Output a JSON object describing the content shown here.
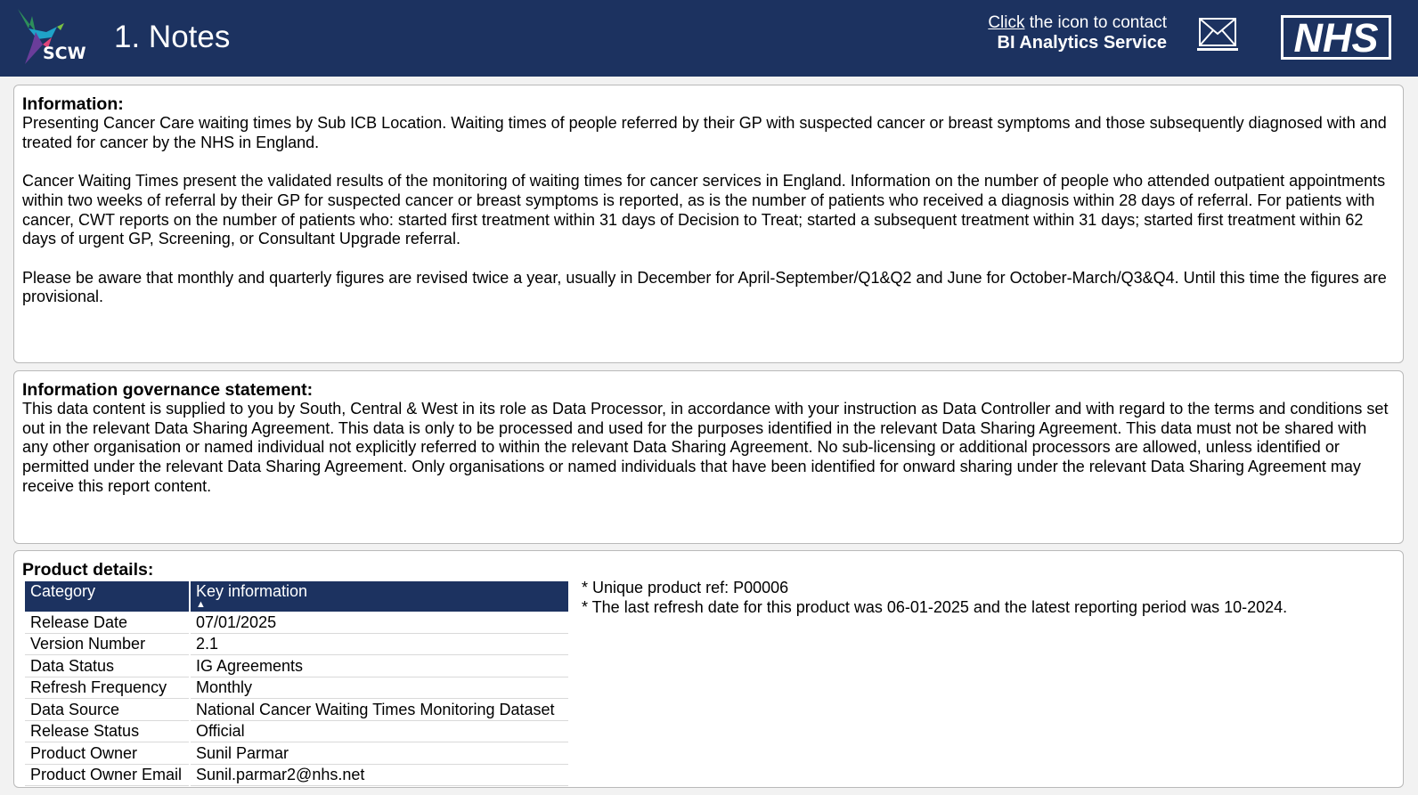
{
  "header": {
    "logo_text": "SCW",
    "title": "1. Notes",
    "contact_link": "Click",
    "contact_text": " the icon to contact",
    "contact_service": "BI Analytics Service",
    "mail_icon": "envelope-icon",
    "nhs_logo_text": "NHS",
    "colors": {
      "header_bg": "#1c3260",
      "text": "#ffffff"
    }
  },
  "information": {
    "heading": "Information:",
    "paragraphs": [
      "Presenting Cancer Care waiting times by Sub ICB Location. Waiting times of people referred by their GP with suspected cancer or breast symptoms and those subsequently diagnosed with and treated for cancer by the NHS in England.",
      "Cancer Waiting Times present the validated results of the monitoring of waiting times for cancer services in England. Information on the number of people who attended outpatient appointments within two weeks of referral by their GP for suspected cancer or breast symptoms is reported, as is the number of patients who received a diagnosis within 28 days of referral. For patients with cancer, CWT reports on the number of patients who: started first treatment within 31 days of Decision to Treat; started a subsequent treatment within 31 days; started first treatment within 62 days of urgent GP, Screening, or Consultant Upgrade referral.",
      "Please be aware that monthly and quarterly figures are revised twice a year, usually in December for April-September/Q1&Q2 and June for October-March/Q3&Q4. Until this time the figures are provisional."
    ]
  },
  "governance": {
    "heading": "Information governance statement:",
    "text": "This data content is supplied to you by South, Central & West in its role as Data Processor, in accordance with your instruction as Data Controller and with regard to the terms and conditions set out in the relevant Data Sharing Agreement. This data is only to be processed and used for the purposes identified in the relevant Data Sharing Agreement. This data must not be shared with any other organisation or named individual not explicitly referred to within the relevant Data Sharing Agreement. No sub-licensing or additional processors are allowed, unless identified or permitted under the relevant Data Sharing Agreement. Only organisations or named individuals that have been identified for onward sharing under the relevant Data Sharing Agreement may receive this report content."
  },
  "product": {
    "heading": "Product details:",
    "columns": [
      "Category",
      "Key information"
    ],
    "sort_icon": "sort-ascending-icon",
    "rows": [
      [
        "Release Date",
        "07/01/2025"
      ],
      [
        "Version Number",
        "2.1"
      ],
      [
        "Data Status",
        "IG Agreements"
      ],
      [
        "Refresh Frequency",
        "Monthly"
      ],
      [
        "Data Source",
        "National Cancer Waiting Times Monitoring Dataset"
      ],
      [
        "Release Status",
        "Official"
      ],
      [
        "Product Owner",
        "Sunil Parmar"
      ],
      [
        "Product Owner Email",
        "Sunil.parmar2@nhs.net"
      ]
    ],
    "notes": [
      "* Unique product ref: P00006",
      "* The last refresh date for this product was 06-01-2025 and the latest reporting period was 10-2024."
    ]
  }
}
